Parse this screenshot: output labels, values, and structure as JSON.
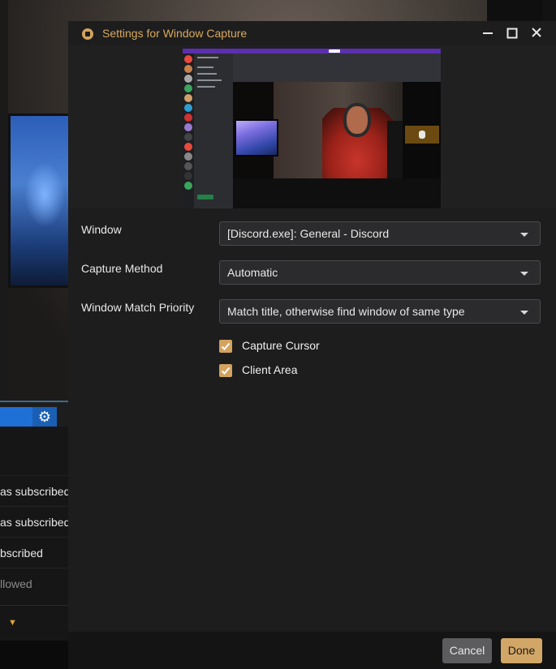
{
  "dialog": {
    "title": "Settings for Window Capture",
    "window_label": "Window",
    "window_value": "[Discord.exe]: General - Discord",
    "capture_method_label": "Capture Method",
    "capture_method_value": "Automatic",
    "match_priority_label": "Window Match Priority",
    "match_priority_value": "Match title, otherwise find window of same type",
    "capture_cursor_label": "Capture Cursor",
    "capture_cursor_checked": true,
    "client_area_label": "Client Area",
    "client_area_checked": true,
    "cancel_label": "Cancel",
    "done_label": "Done",
    "accent_color": "#d3a35f"
  },
  "background_app": {
    "rows": [
      "as subscribed",
      "as subscribed",
      "bscribed",
      "llowed"
    ]
  }
}
